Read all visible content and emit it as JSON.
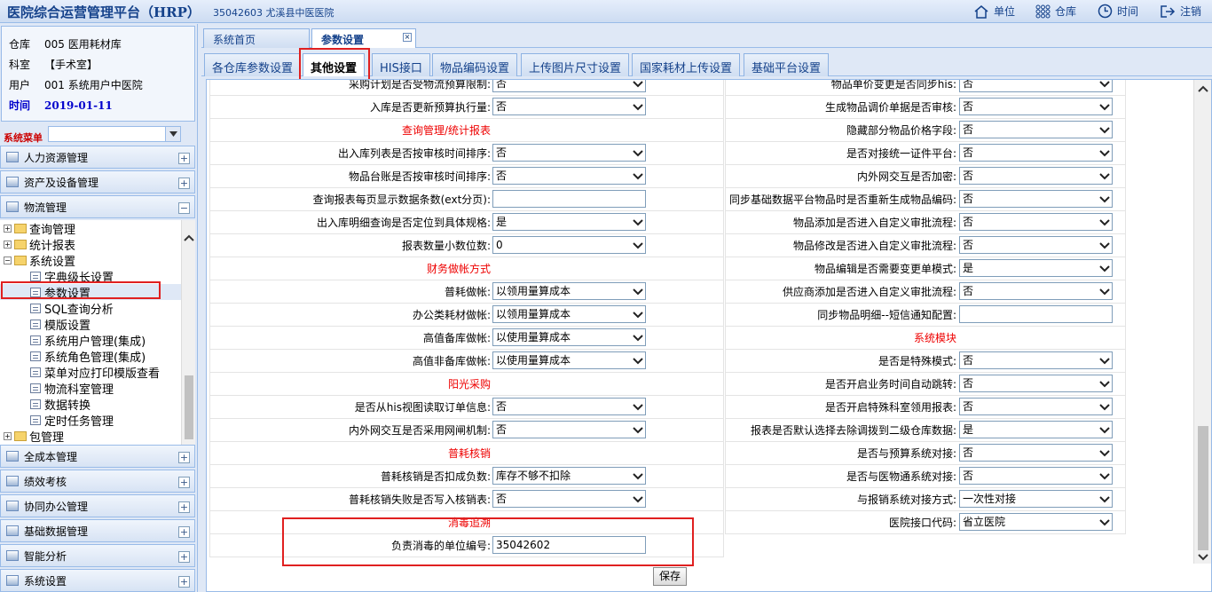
{
  "header": {
    "title": "医院综合运营管理平台（HRP）",
    "code_info": "35042603  尤溪县中医医院",
    "toolbar": [
      {
        "label": "单位",
        "icon": "home-icon"
      },
      {
        "label": "仓库",
        "icon": "grid-icon"
      },
      {
        "label": "时间",
        "icon": "clock-icon"
      },
      {
        "label": "注销",
        "icon": "logout-icon"
      }
    ]
  },
  "info": {
    "warehouse_k": "仓库",
    "warehouse_v": "005  医用耗材库",
    "dept_k": "科室",
    "dept_v": "【手术室】",
    "user_k": "用户",
    "user_v": "001  系统用户中医院",
    "time_k": "时间",
    "time_v": "2019-01-11"
  },
  "menu_label": "系统菜单",
  "accordion_top": [
    "人力资源管理",
    "资产及设备管理",
    "物流管理"
  ],
  "tree": [
    "查询管理",
    "统计报表",
    "系统设置",
    "字典级长设置",
    "参数设置",
    "SQL查询分析",
    "模版设置",
    "系统用户管理(集成)",
    "系统角色管理(集成)",
    "菜单对应打印模版查看",
    "物流科室管理",
    "数据转换",
    "定时任务管理",
    "包管理"
  ],
  "accordion_bottom": [
    "全成本管理",
    "绩效考核",
    "协同办公管理",
    "基础数据管理",
    "智能分析",
    "系统设置"
  ],
  "tabs1": [
    "系统首页",
    "参数设置"
  ],
  "tabs2": [
    "各仓库参数设置",
    "其他设置",
    "HIS接口",
    "物品编码设置",
    "上传图片尺寸设置",
    "国家耗材上传设置",
    "基础平台设置"
  ],
  "left_rows": [
    {
      "label": "采购计划是否受物流预算限制:",
      "value": "否",
      "type": "select"
    },
    {
      "label": "入库是否更新预算执行量:",
      "value": "否",
      "type": "select"
    },
    {
      "section": "查询管理/统计报表"
    },
    {
      "label": "出入库列表是否按审核时间排序:",
      "value": "否",
      "type": "select"
    },
    {
      "label": "物品台账是否按审核时间排序:",
      "value": "否",
      "type": "select"
    },
    {
      "label": "查询报表每页显示数据条数(ext分页):",
      "value": "",
      "type": "text"
    },
    {
      "label": "出入库明细查询是否定位到具体规格:",
      "value": "是",
      "type": "select"
    },
    {
      "label": "报表数量小数位数:",
      "value": "0",
      "type": "select"
    },
    {
      "section": "财务做帐方式"
    },
    {
      "label": "普耗做帐:",
      "value": "以领用量算成本",
      "type": "select"
    },
    {
      "label": "办公类耗材做帐:",
      "value": "以领用量算成本",
      "type": "select"
    },
    {
      "label": "高值备库做帐:",
      "value": "以使用量算成本",
      "type": "select"
    },
    {
      "label": "高值非备库做帐:",
      "value": "以使用量算成本",
      "type": "select"
    },
    {
      "section": "阳光采购"
    },
    {
      "label": "是否从his视图读取订单信息:",
      "value": "否",
      "type": "select"
    },
    {
      "label": "内外网交互是否采用网闸机制:",
      "value": "否",
      "type": "select"
    },
    {
      "section": "普耗核销"
    },
    {
      "label": "普耗核销是否扣成负数:",
      "value": "库存不够不扣除",
      "type": "select"
    },
    {
      "label": "普耗核销失败是否写入核销表:",
      "value": "否",
      "type": "select"
    },
    {
      "section": "消毒追溯"
    },
    {
      "label": "负责消毒的单位编号:",
      "value": "35042602",
      "type": "text"
    }
  ],
  "right_rows": [
    {
      "label": "物品单价变更是否同步his:",
      "value": "否",
      "type": "select"
    },
    {
      "label": "生成物品调价单据是否审核:",
      "value": "否",
      "type": "select"
    },
    {
      "label": "隐藏部分物品价格字段:",
      "value": "否",
      "type": "select"
    },
    {
      "label": "是否对接统一证件平台:",
      "value": "否",
      "type": "select"
    },
    {
      "label": "内外网交互是否加密:",
      "value": "否",
      "type": "select"
    },
    {
      "label": "同步基础数据平台物品时是否重新生成物品编码:",
      "value": "否",
      "type": "select"
    },
    {
      "label": "物品添加是否进入自定义审批流程:",
      "value": "否",
      "type": "select"
    },
    {
      "label": "物品修改是否进入自定义审批流程:",
      "value": "否",
      "type": "select"
    },
    {
      "label": "物品编辑是否需要变更单模式:",
      "value": "是",
      "type": "select"
    },
    {
      "label": "供应商添加是否进入自定义审批流程:",
      "value": "否",
      "type": "select"
    },
    {
      "label": "同步物品明细--短信通知配置:",
      "value": "",
      "type": "text"
    },
    {
      "section": "系统模块"
    },
    {
      "label": "是否是特殊模式:",
      "value": "否",
      "type": "select"
    },
    {
      "label": "是否开启业务时间自动跳转:",
      "value": "否",
      "type": "select"
    },
    {
      "label": "是否开启特殊科室领用报表:",
      "value": "否",
      "type": "select"
    },
    {
      "label": "报表是否默认选择去除调拨到二级仓库数据:",
      "value": "是",
      "type": "select"
    },
    {
      "label": "是否与预算系统对接:",
      "value": "否",
      "type": "select"
    },
    {
      "label": "是否与医物通系统对接:",
      "value": "否",
      "type": "select"
    },
    {
      "label": "与报销系统对接方式:",
      "value": "一次性对接",
      "type": "select"
    },
    {
      "label": "医院接口代码:",
      "value": "省立医院",
      "type": "select"
    }
  ],
  "save_label": "保存"
}
